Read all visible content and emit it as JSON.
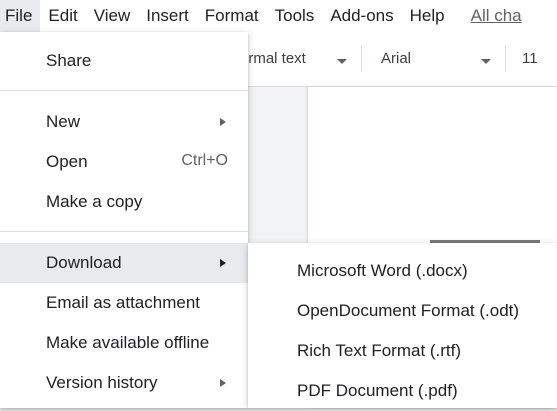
{
  "menubar": {
    "items": [
      "File",
      "Edit",
      "View",
      "Insert",
      "Format",
      "Tools",
      "Add-ons",
      "Help"
    ],
    "last_edit": "All cha"
  },
  "toolbar": {
    "style": "ormal text",
    "font": "Arial",
    "size": "11"
  },
  "file_menu": {
    "share": "Share",
    "new": "New",
    "open": "Open",
    "open_shortcut": "Ctrl+O",
    "make_copy": "Make a copy",
    "download": "Download",
    "email": "Email as attachment",
    "offline": "Make available offline",
    "version_history": "Version history"
  },
  "download_submenu": {
    "items": [
      "Microsoft Word (.docx)",
      "OpenDocument Format (.odt)",
      "Rich Text Format (.rtf)",
      "PDF Document (.pdf)"
    ]
  }
}
